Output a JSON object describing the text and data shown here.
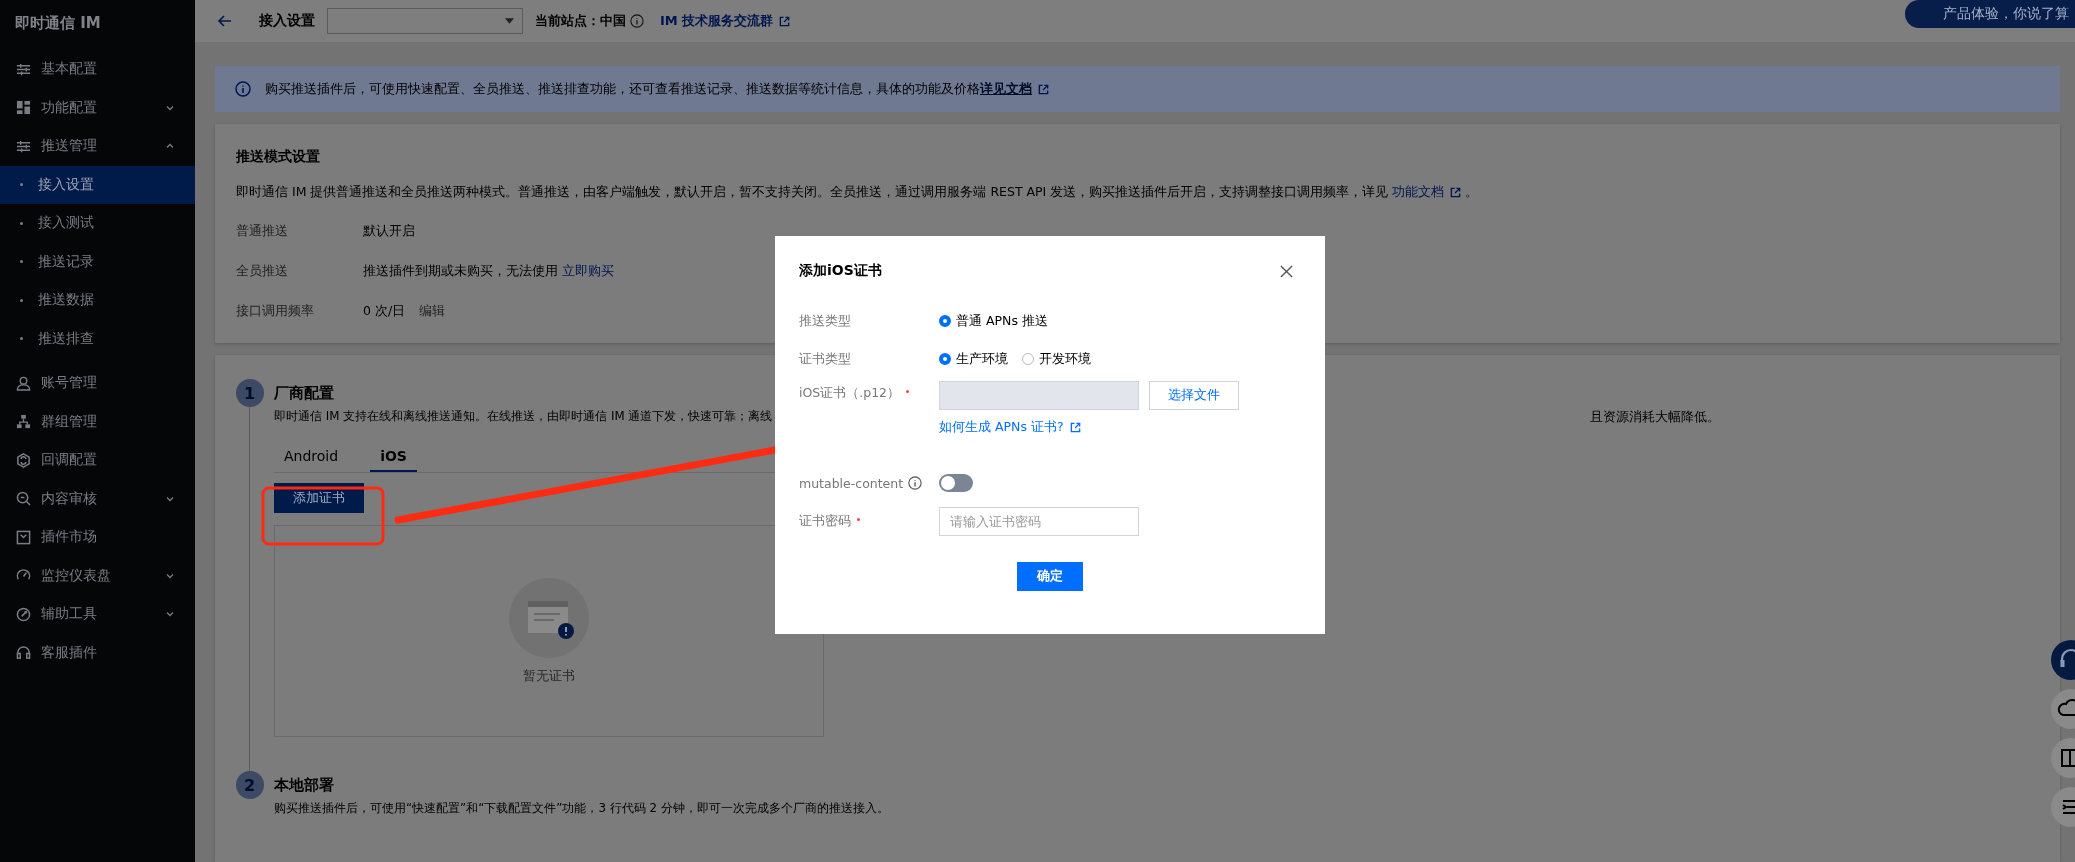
{
  "sidebar": {
    "title": "即时通信 IM",
    "items": [
      {
        "label": "基本配置",
        "selected": false
      },
      {
        "label": "功能配置",
        "expanded": false,
        "selected": false
      },
      {
        "label": "推送管理",
        "expanded": true,
        "selected": false,
        "children": [
          {
            "label": "接入设置",
            "selected": true
          },
          {
            "label": "接入测试",
            "selected": false
          },
          {
            "label": "推送记录",
            "selected": false
          },
          {
            "label": "推送数据",
            "selected": false
          },
          {
            "label": "推送排查",
            "selected": false
          }
        ]
      },
      {
        "label": "账号管理",
        "selected": false
      },
      {
        "label": "群组管理",
        "selected": false
      },
      {
        "label": "回调配置",
        "selected": false
      },
      {
        "label": "内容审核",
        "expanded": false,
        "selected": false
      },
      {
        "label": "插件市场",
        "selected": false
      },
      {
        "label": "监控仪表盘",
        "expanded": false,
        "selected": false
      },
      {
        "label": "辅助工具",
        "expanded": false,
        "selected": false
      },
      {
        "label": "客服插件",
        "selected": false
      }
    ]
  },
  "header": {
    "title": "接入设置",
    "site": "当前站点：中国",
    "group_link": "IM 技术服务交流群",
    "feedback": "产品体验，你说了算"
  },
  "notice": {
    "text": "购买推送插件后，可使用快速配置、全员推送、推送排查功能，还可查看推送记录、推送数据等统计信息，具体的功能及价格",
    "link": "详见文档"
  },
  "push_mode": {
    "title": "推送模式设置",
    "description": "即时通信 IM 提供普通推送和全员推送两种模式。普通推送，由客户端触发，默认开启，暂不支持关闭。全员推送，通过调用服务端 REST API 发送，购买推送插件后开启，支持调整接口调用频率，详见",
    "doc_link": "功能文档",
    "description_end": "。",
    "rows": [
      {
        "label": "普通推送",
        "value": "默认开启"
      },
      {
        "label": "全员推送",
        "value": "推送插件到期或未购买，无法使用",
        "link": "立即购买"
      },
      {
        "label": "接口调用频率",
        "value": "0 次/日",
        "link": "编辑"
      }
    ]
  },
  "steps": [
    {
      "number": "1",
      "title": "厂商配置",
      "description": "即时通信 IM 支持在线和离线推送通知。在线推送，由即时通信 IM 通道下发，快速可靠；离线",
      "description_tail": "且资源消耗大幅降低。",
      "tabs": [
        {
          "label": "Android",
          "selected": false
        },
        {
          "label": "iOS",
          "selected": true
        }
      ],
      "button": "添加证书",
      "empty": "暂无证书"
    },
    {
      "number": "2",
      "title": "本地部署",
      "description": "购买推送插件后，可使用“快速配置”和“下载配置文件”功能，3 行代码 2 分钟，即可一次完成多个厂商的推送接入。"
    }
  ],
  "dialog": {
    "title": "添加iOS证书",
    "push_type": {
      "label": "推送类型",
      "options": [
        {
          "label": "普通 APNs 推送",
          "selected": true
        }
      ]
    },
    "cert_type": {
      "label": "证书类型",
      "options": [
        {
          "label": "生产环境",
          "selected": true
        },
        {
          "label": "开发环境",
          "selected": false
        }
      ]
    },
    "cert_file": {
      "label": "iOS证书（.p12）",
      "required": true,
      "disabled": true,
      "button": "选择文件",
      "help_link": "如何生成 APNs 证书?"
    },
    "mutable_content": {
      "label": "mutable-content",
      "on": false
    },
    "password": {
      "label": "证书密码",
      "required": true,
      "placeholder": "请输入证书密码"
    },
    "confirm": "确定"
  }
}
